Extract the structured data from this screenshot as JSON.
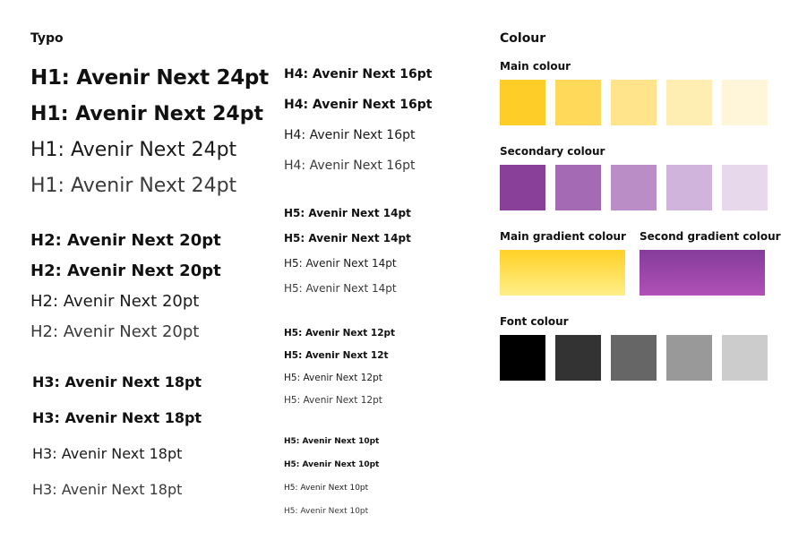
{
  "typo": {
    "title": "Typo",
    "h1": [
      "H1: Avenir Next 24pt",
      "H1: Avenir Next 24pt",
      "H1: Avenir Next 24pt",
      "H1: Avenir Next 24pt"
    ],
    "h2": [
      "H2: Avenir Next 20pt",
      "H2: Avenir Next 20pt",
      "H2: Avenir Next 20pt",
      "H2: Avenir Next 20pt"
    ],
    "h3": [
      "H3: Avenir Next 18pt",
      "H3: Avenir Next 18pt",
      "H3: Avenir Next 18pt",
      "H3: Avenir Next 18pt"
    ],
    "h4": [
      "H4: Avenir Next 16pt",
      "H4: Avenir Next 16pt",
      "H4: Avenir Next 16pt",
      "H4: Avenir Next 16pt"
    ],
    "h5_14": [
      "H5: Avenir Next 14pt",
      "H5: Avenir Next 14pt",
      "H5: Avenir Next 14pt",
      "H5: Avenir Next 14pt"
    ],
    "h5_12": [
      "H5: Avenir Next 12pt",
      "H5: Avenir Next 12t",
      "H5: Avenir Next 12pt",
      "H5: Avenir Next 12pt"
    ],
    "h5_10": [
      "H5: Avenir Next 10pt",
      "H5: Avenir Next 10pt",
      "H5: Avenir Next 10pt",
      "H5: Avenir Next 10pt"
    ]
  },
  "colour": {
    "title": "Colour",
    "main": {
      "label": "Main colour",
      "swatches": [
        "#FFCD27",
        "#FFD95A",
        "#FFE48C",
        "#FFEEB2",
        "#FFF5D9"
      ]
    },
    "secondary": {
      "label": "Secondary colour",
      "swatches": [
        "#884099",
        "#A46AB4",
        "#BA8DC6",
        "#D1B4DB",
        "#E7D8EC"
      ]
    },
    "main_gradient": {
      "label": "Main gradient colour",
      "from": "#FFD126",
      "to": "#FFEE88"
    },
    "second_gradient": {
      "label": "Second gradient colour",
      "from": "#843C9A",
      "to": "#B150B6"
    },
    "font": {
      "label": "Font colour",
      "swatches": [
        "#000000",
        "#333333",
        "#666666",
        "#999999",
        "#CCCCCC"
      ]
    }
  }
}
